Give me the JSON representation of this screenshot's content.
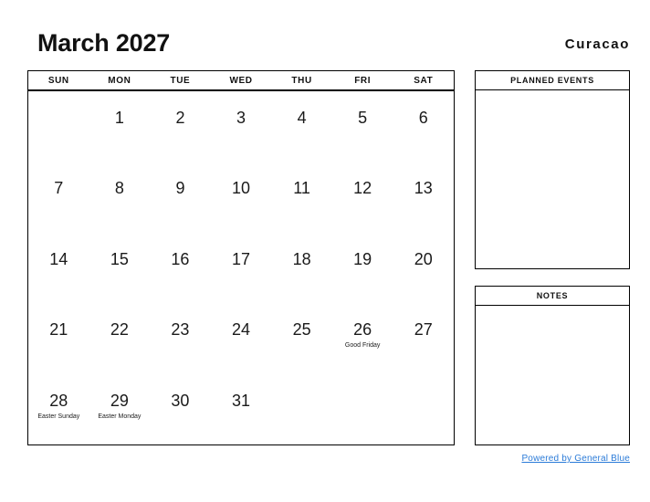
{
  "header": {
    "title": "March 2027",
    "region": "Curacao"
  },
  "calendar": {
    "weekdays": [
      "SUN",
      "MON",
      "TUE",
      "WED",
      "THU",
      "FRI",
      "SAT"
    ],
    "weeks": [
      [
        {
          "day": "",
          "event": ""
        },
        {
          "day": "1",
          "event": ""
        },
        {
          "day": "2",
          "event": ""
        },
        {
          "day": "3",
          "event": ""
        },
        {
          "day": "4",
          "event": ""
        },
        {
          "day": "5",
          "event": ""
        },
        {
          "day": "6",
          "event": ""
        }
      ],
      [
        {
          "day": "7",
          "event": ""
        },
        {
          "day": "8",
          "event": ""
        },
        {
          "day": "9",
          "event": ""
        },
        {
          "day": "10",
          "event": ""
        },
        {
          "day": "11",
          "event": ""
        },
        {
          "day": "12",
          "event": ""
        },
        {
          "day": "13",
          "event": ""
        }
      ],
      [
        {
          "day": "14",
          "event": ""
        },
        {
          "day": "15",
          "event": ""
        },
        {
          "day": "16",
          "event": ""
        },
        {
          "day": "17",
          "event": ""
        },
        {
          "day": "18",
          "event": ""
        },
        {
          "day": "19",
          "event": ""
        },
        {
          "day": "20",
          "event": ""
        }
      ],
      [
        {
          "day": "21",
          "event": ""
        },
        {
          "day": "22",
          "event": ""
        },
        {
          "day": "23",
          "event": ""
        },
        {
          "day": "24",
          "event": ""
        },
        {
          "day": "25",
          "event": ""
        },
        {
          "day": "26",
          "event": "Good Friday"
        },
        {
          "day": "27",
          "event": ""
        }
      ],
      [
        {
          "day": "28",
          "event": "Easter Sunday"
        },
        {
          "day": "29",
          "event": "Easter Monday"
        },
        {
          "day": "30",
          "event": ""
        },
        {
          "day": "31",
          "event": ""
        },
        {
          "day": "",
          "event": ""
        },
        {
          "day": "",
          "event": ""
        },
        {
          "day": "",
          "event": ""
        }
      ]
    ]
  },
  "panels": {
    "planned_events": {
      "title": "PLANNED EVENTS",
      "content": ""
    },
    "notes": {
      "title": "NOTES",
      "content": ""
    }
  },
  "footer": {
    "link_text": "Powered by General Blue",
    "link_color": "#2b7bd8"
  }
}
